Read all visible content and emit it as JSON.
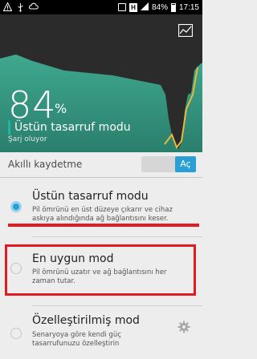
{
  "status_bar": {
    "left_icons": [
      "warning-icon",
      "usb-icon",
      "cloud-icon"
    ],
    "right_icons": [
      "notification-icon",
      "h-network-icon",
      "signal-icon",
      "battery-icon"
    ],
    "h_label": "H",
    "battery_percent": "84%",
    "time": "17:15"
  },
  "header": {
    "percent": "84",
    "percent_sign": "%",
    "mode": "Üstün tasarruf modu",
    "charging": "Şarj oluyor",
    "accent_color": "#1fb4a8",
    "graph_color": "#2f9b85"
  },
  "smart_saving": {
    "label": "Akıllı kaydetme",
    "toggle_label": "Aç",
    "toggle_on": true
  },
  "options": [
    {
      "title": "Üstün tasarruf modu",
      "desc_line1": "Pil ömrünü en üst düzeye çıkarır ve cihaz",
      "desc_line2": "askıya alındığında ağ bağlantısını keser.",
      "selected": true
    },
    {
      "title": "En uygun mod",
      "desc_line1": "Pil ömrünü uzatır ve ağ bağlantısını her",
      "desc_line2": "zaman tutar.",
      "selected": false
    },
    {
      "title": "Özelleştirilmiş mod",
      "desc_line1": "Senaryoya göre kendi güç",
      "desc_line2": "tasarrufunuzu özelleştirin",
      "selected": false
    }
  ],
  "annotation_color": "#e21a22"
}
